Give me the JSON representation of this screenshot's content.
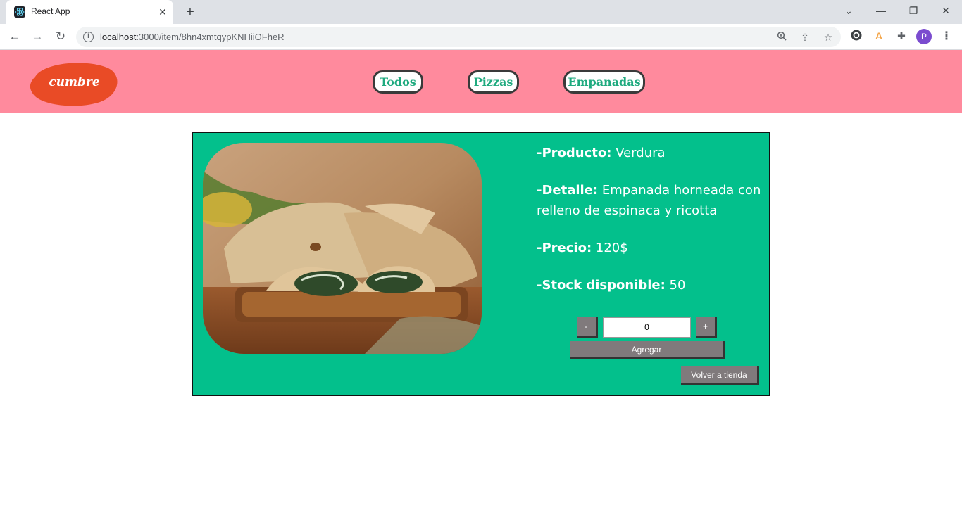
{
  "browser": {
    "tab_title": "React App",
    "tab_close": "✕",
    "new_tab": "+",
    "url_host": "localhost",
    "url_path": ":3000/item/8hn4xmtqypKNHiiOFheR",
    "avatar_letter": "P"
  },
  "site": {
    "logo_text": "cumbre",
    "nav": [
      {
        "label": "Todos"
      },
      {
        "label": "Pizzas"
      },
      {
        "label": "Empanadas"
      }
    ]
  },
  "product": {
    "name_label": "-Producto:",
    "name": "Verdura",
    "detail_label": "-Detalle:",
    "detail": "Empanada horneada con relleno de espinaca y ricotta",
    "price_label": "-Precio:",
    "price": "120$",
    "stock_label": "-Stock disponible:",
    "stock": "50"
  },
  "counter": {
    "minus": "-",
    "value": "0",
    "plus": "+"
  },
  "actions": {
    "add": "Agregar",
    "back": "Volver a tienda"
  },
  "colors": {
    "navbar": "#ff8a9d",
    "card": "#03c08c",
    "logo": "#e94b26",
    "nav_text": "#1faa7f",
    "button": "#807a7c"
  }
}
